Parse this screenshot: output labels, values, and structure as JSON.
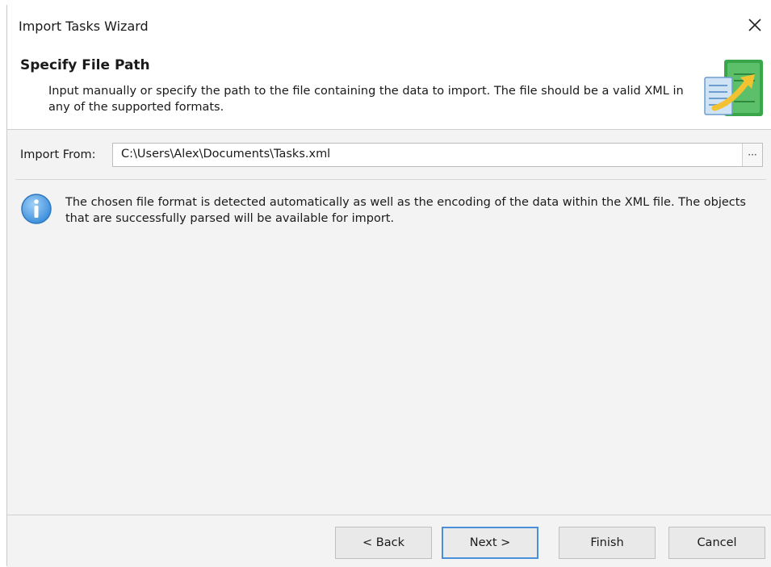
{
  "window": {
    "title": "Import Tasks Wizard",
    "close_symbol": "✕"
  },
  "header": {
    "title": "Specify File Path",
    "description": "Input manually or specify the path to the file containing the data to import. The file should be a valid XML in any of the supported formats.",
    "icon": "import-document-icon"
  },
  "form": {
    "import_from_label": "Import From:",
    "import_from_value": "C:\\Users\\Alex\\Documents\\Tasks.xml",
    "browse_label": "···"
  },
  "info": {
    "icon": "info-icon",
    "text": "The chosen file format is detected automatically as well as the encoding of the data within the XML file. The objects that are successfully parsed will be available for import."
  },
  "buttons": {
    "back": "< Back",
    "next": "Next >",
    "finish": "Finish",
    "cancel": "Cancel"
  },
  "colors": {
    "accent": "#4a90d9",
    "info_blue": "#3d8fdc",
    "icon_green": "#3aa64a",
    "arrow_yellow": "#f2c230"
  }
}
